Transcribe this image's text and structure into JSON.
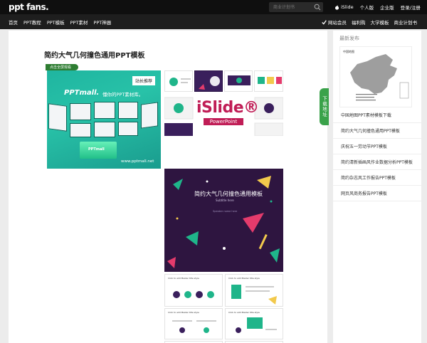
{
  "header": {
    "logo": "ppt fans.",
    "search_placeholder": "商业计划书",
    "links": [
      {
        "label": "iSlide",
        "icon": "apple-icon"
      },
      {
        "label": "个人版"
      },
      {
        "label": "企业版"
      },
      {
        "label": "登录/注册"
      }
    ]
  },
  "nav": {
    "left": [
      "首页",
      "PPT教程",
      "PPT模板",
      "PPT素材",
      "PPT神器"
    ],
    "right": [
      {
        "label": "网站会员",
        "icon": "check-icon"
      },
      {
        "label": "福利购"
      },
      {
        "label": "大学模板"
      },
      {
        "label": "商业计划书"
      }
    ]
  },
  "article": {
    "title": "简约大气几何撞色通用PPT模板",
    "fullscreen_label": "点击全屏观看"
  },
  "promo": {
    "brand": "PPTmall.",
    "tagline": "懂你的PPT素材库。",
    "badge": "站长推荐",
    "url": "www.pptmall.net",
    "box_label": "PPTmall"
  },
  "islide": {
    "title": "iSlide®",
    "subtitle": "PowerPoint"
  },
  "hero": {
    "title": "简约大气几何撞色通用模板",
    "subtitle": "Subtitle here",
    "note": "Speaker name here"
  },
  "slides": {
    "headline": "Click to add Master title style"
  },
  "download_tab": "下载地址",
  "sidebar": {
    "title": "最新发布",
    "map_label": "中国地图",
    "items": [
      "中国地图PPT素材模板下载",
      "简约大气几何撞色通用PPT模板",
      "庆祝五一劳动节PPT模板",
      "简约清新插画风作业数据分析PPT模板",
      "简约杂志风工作报告PPT模板",
      "网页风商务报告PPT模板"
    ]
  },
  "colors": {
    "topbar": "#0f0f0f",
    "navbar": "#1e1e1e",
    "accent_green": "#3aa24a",
    "promo_teal": "#1fb5a0",
    "islide_red": "#c01d56",
    "hero_purple": "#2e1540"
  }
}
